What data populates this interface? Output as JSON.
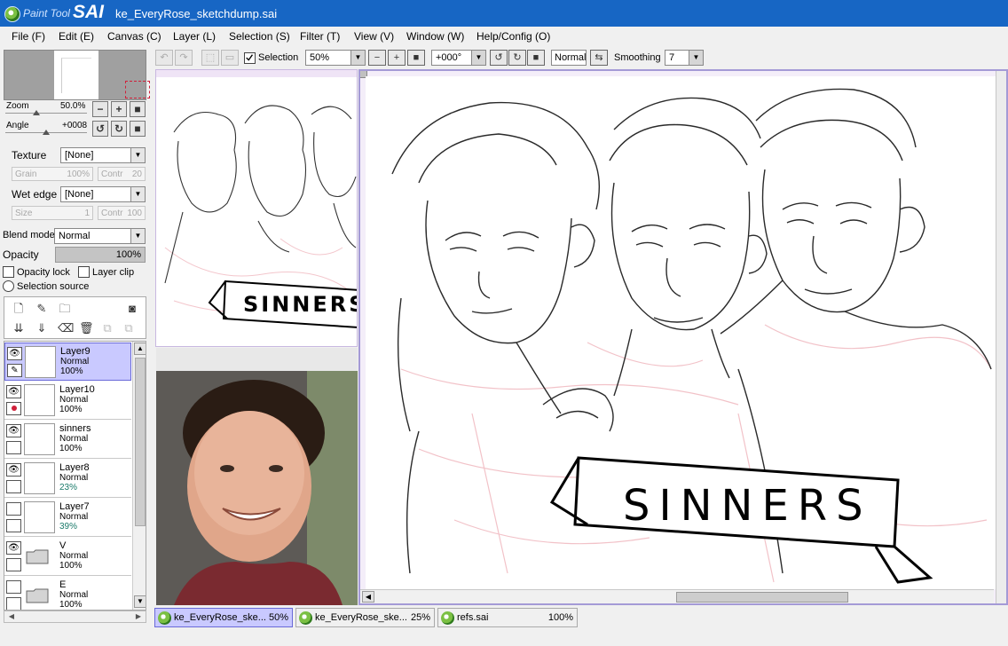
{
  "app": {
    "logo_small": "Paint Tool",
    "logo_big": "SAI",
    "window_title": "ke_EveryRose_sketchdump.sai"
  },
  "menu": [
    {
      "label": "File (F)"
    },
    {
      "label": "Edit (E)"
    },
    {
      "label": "Canvas (C)"
    },
    {
      "label": "Layer (L)"
    },
    {
      "label": "Selection (S)"
    },
    {
      "label": "Filter (T)"
    },
    {
      "label": "View (V)"
    },
    {
      "label": "Window (W)"
    },
    {
      "label": "Help/Config (O)"
    }
  ],
  "navigator": {
    "zoom_label": "Zoom",
    "zoom_value": "50.0%",
    "angle_label": "Angle",
    "angle_value": "+0008"
  },
  "brush": {
    "texture_label": "Texture",
    "texture_value": "[None]",
    "grain_label": "Grain",
    "grain_value": "100%",
    "contr_label": "Contr",
    "contr1_value": "20",
    "wet_edge_label": "Wet edge",
    "wet_edge_value": "[None]",
    "size_label": "Size",
    "size_value": "1",
    "contr2_value": "100"
  },
  "layer_props": {
    "blend_mode_label": "Blend mode",
    "blend_mode_value": "Normal",
    "opacity_label": "Opacity",
    "opacity_value": "100%",
    "opacity_lock": "Opacity lock",
    "layer_clip": "Layer clip",
    "selection_source": "Selection source"
  },
  "layers": [
    {
      "name": "Layer9",
      "mode": "Normal",
      "opacity": "100%"
    },
    {
      "name": "Layer10",
      "mode": "Normal",
      "opacity": "100%"
    },
    {
      "name": "sinners",
      "mode": "Normal",
      "opacity": "100%"
    },
    {
      "name": "Layer8",
      "mode": "Normal",
      "opacity": "23%"
    },
    {
      "name": "Layer7",
      "mode": "Normal",
      "opacity": "39%"
    },
    {
      "name": "V",
      "mode": "Normal",
      "opacity": "100%"
    },
    {
      "name": "E",
      "mode": "Normal",
      "opacity": "100%"
    }
  ],
  "toolbar": {
    "selection_label": "Selection",
    "zoom_value": "50%",
    "angle_value": "+000°",
    "blend_value": "Normal",
    "smoothing_label": "Smoothing",
    "smoothing_value": "7"
  },
  "canvas": {
    "banner_text": "SINNERS"
  },
  "tabs": [
    {
      "name": "ke_EveryRose_ske...",
      "zoom": "50%"
    },
    {
      "name": "ke_EveryRose_ske...",
      "zoom": "25%"
    },
    {
      "name": "refs.sai",
      "zoom": "100%"
    }
  ],
  "colors": {
    "titlebar": "#1766c4",
    "selection": "#c9c9ff",
    "accent": "#6a6ad8"
  }
}
